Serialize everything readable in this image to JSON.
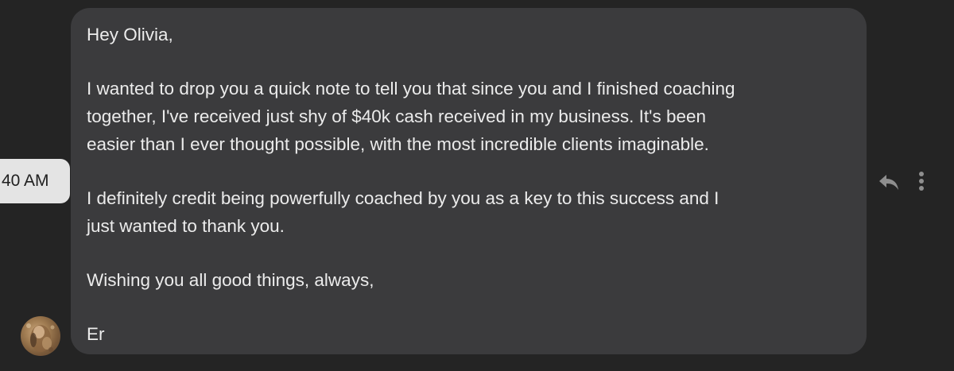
{
  "message": {
    "timestamp": "40 AM",
    "paragraphs": [
      "Hey Olivia,",
      "I wanted to drop you a quick note to tell you that since you and I finished coaching\ntogether, I've received just shy of $40k cash received in my business. It's been\neasier than I ever thought possible, with the most incredible clients imaginable.",
      "I definitely credit being powerfully coached by you as a key to this success and I\njust wanted to thank you.",
      "Wishing you all good things, always,",
      "Er"
    ]
  },
  "icons": {
    "reply": "reply-icon",
    "more": "more-vertical-icon",
    "avatar": "avatar"
  },
  "colors": {
    "background": "#242424",
    "bubble": "#3b3b3d",
    "text": "#ececec",
    "timestamp_pill": "#e4e4e4",
    "icon": "#8e8e8e"
  }
}
